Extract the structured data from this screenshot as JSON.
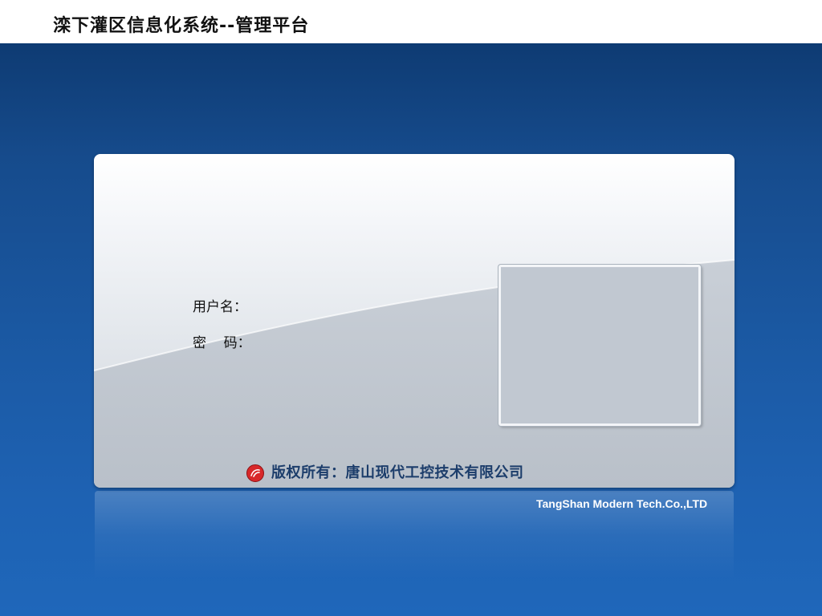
{
  "header": {
    "title": "滦下灌区信息化系统--管理平台"
  },
  "login": {
    "username_label": "用户名：",
    "password_label": "密    码："
  },
  "footer": {
    "copyright": "版权所有：唐山现代工控技术有限公司",
    "company_en": "TangShan Modern Tech.Co.,LTD",
    "logo_icon": "company-logo-icon"
  },
  "colors": {
    "header_bg": "#ffffff",
    "background_blue": "#1e5aa6",
    "copyright_text": "#1c3d6b",
    "logo_red": "#d8282a"
  }
}
